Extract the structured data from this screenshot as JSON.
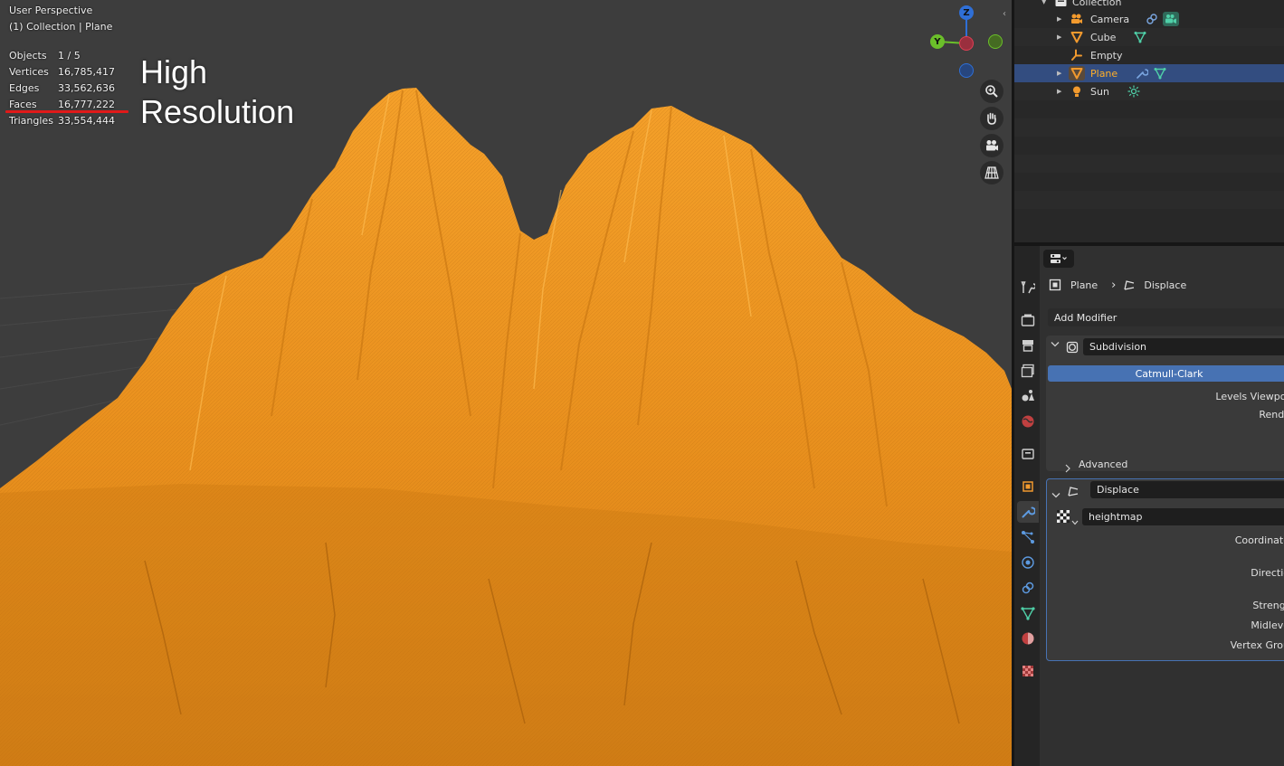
{
  "viewport": {
    "title": "User Perspective",
    "subtitle": "(1) Collection | Plane",
    "stats": [
      {
        "label": "Objects",
        "value": "1 / 5"
      },
      {
        "label": "Vertices",
        "value": "16,785,417"
      },
      {
        "label": "Edges",
        "value": "33,562,636"
      },
      {
        "label": "Faces",
        "value": "16,777,222"
      },
      {
        "label": "Triangles",
        "value": "33,554,444"
      }
    ],
    "annotation_line1": "High",
    "annotation_line2": "Resolution",
    "gizmo": {
      "z": "Z",
      "y": "Y"
    },
    "tools": [
      "zoom-icon",
      "hand-pan-icon",
      "camera-view-icon",
      "ortho-grid-icon"
    ],
    "colors": {
      "terrain": "#f0951e",
      "background": "#3d3d3d",
      "annotation_line": "#e01919"
    }
  },
  "outliner": {
    "collection": "Collection",
    "items": [
      {
        "label": "Camera",
        "icon": "camera-icon",
        "extras": [
          "constraint-icon",
          "camera-data-icon"
        ]
      },
      {
        "label": "Cube",
        "icon": "mesh-object-icon",
        "extras": [
          "mesh-data-icon"
        ]
      },
      {
        "label": "Empty",
        "icon": "empty-icon",
        "extras": []
      },
      {
        "label": "Plane",
        "icon": "mesh-object-icon",
        "extras": [
          "modifier-wrench-icon",
          "mesh-data-icon"
        ],
        "selected": true
      },
      {
        "label": "Sun",
        "icon": "light-icon",
        "extras": [
          "sun-data-icon"
        ]
      }
    ]
  },
  "properties": {
    "breadcrumb": {
      "object": "Plane",
      "modifier": "Displace"
    },
    "add_modifier": "Add Modifier",
    "subdivision": {
      "name": "Subdivision",
      "mode": "Catmull-Clark",
      "levels_viewport": "Levels Viewpor",
      "render": "Rende",
      "advanced": "Advanced"
    },
    "displace": {
      "name": "Displace",
      "texture": "heightmap",
      "coordinates": "Coordinate",
      "direction": "Directio",
      "strength": "Strengt",
      "midlevel": "Midleve",
      "vertex_group": "Vertex Grou"
    }
  }
}
